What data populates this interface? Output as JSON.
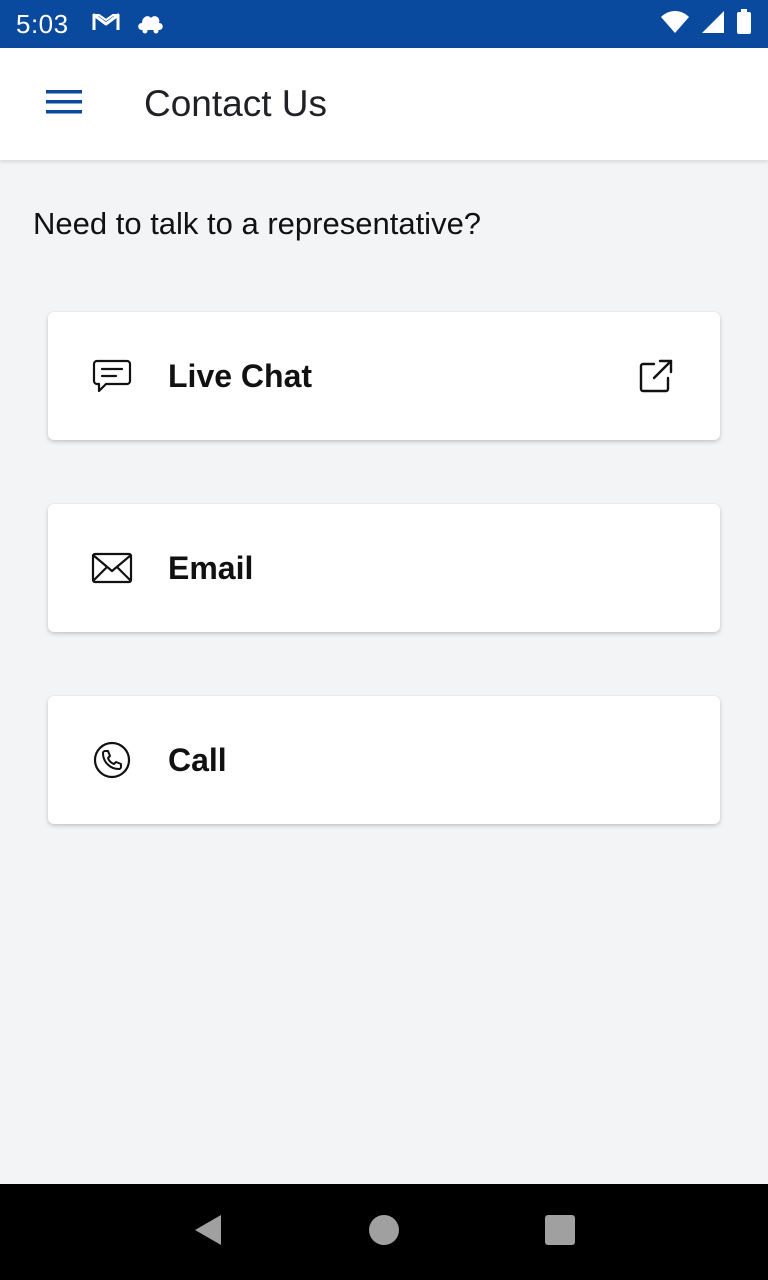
{
  "status_bar": {
    "time": "5:03",
    "icons": [
      "gmail-icon",
      "cloud-icon",
      "wifi-icon",
      "signal-icon",
      "battery-icon"
    ],
    "background_color": "#0a4a9e"
  },
  "app_bar": {
    "title": "Contact Us",
    "menu_icon": "hamburger-menu-icon",
    "accent_color": "#0a4a9e"
  },
  "content": {
    "question": "Need to talk to a representative?",
    "options": [
      {
        "label": "Live Chat",
        "icon": "chat-icon",
        "trailing_icon": "external-link-icon"
      },
      {
        "label": "Email",
        "icon": "mail-icon"
      },
      {
        "label": "Call",
        "icon": "phone-icon"
      }
    ]
  },
  "nav_bar": {
    "buttons": [
      "back-icon",
      "home-icon",
      "recents-icon"
    ]
  }
}
